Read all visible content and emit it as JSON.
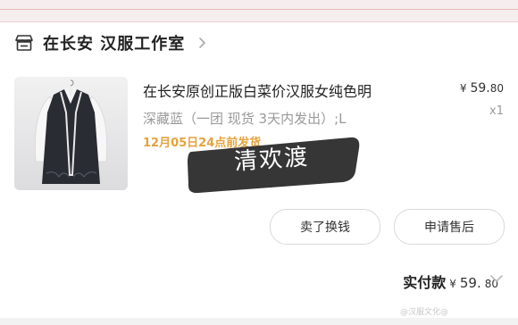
{
  "shop": {
    "icon": "shop-icon",
    "name": "在长安 汉服工作室",
    "chevron_icon": "chevron-right-icon"
  },
  "item": {
    "image": "product-photo",
    "title": "在长安原创正版白菜价汉服女纯色明",
    "sku": "深藏蓝（一团 现货 3天内发出）;L",
    "ship_date": "12月05日24点前发货",
    "price": {
      "currency": "¥",
      "integer": "59.",
      "decimal": "80"
    },
    "quantity": "x1"
  },
  "overlay": {
    "text": "清欢渡"
  },
  "actions": {
    "sell_label": "卖了换钱",
    "after_sale_label": "申请售后"
  },
  "total": {
    "label": "实付款",
    "currency": "¥",
    "integer": "59.",
    "decimal": "80",
    "chevron_icon": "chevron-down-icon"
  },
  "footer": {
    "watermark": "@汉服文化@"
  },
  "colors": {
    "ship_date": "#e6a23c",
    "border": "#d9d9d9",
    "muted": "#999999",
    "topbar": "#f6eeee",
    "overlay_bg": "#2b2b2b"
  }
}
